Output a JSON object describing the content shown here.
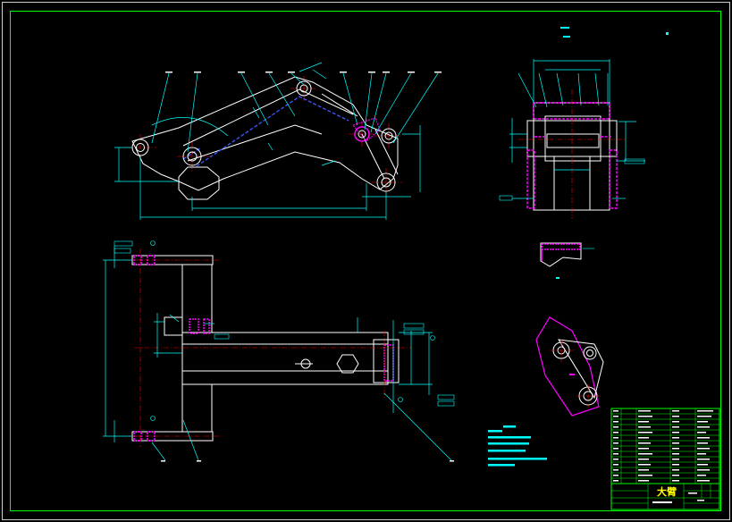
{
  "sheet": {
    "title_block": {
      "part_name": "大臂"
    }
  },
  "colors": {
    "background": "#000000",
    "frame": "#00ff00",
    "outline": "#ffffff",
    "dimension": "#00ffff",
    "centerline": "#ff0000",
    "hatch": "#ff00ff",
    "hidden": "#0000ff",
    "note_text": "#00ffff"
  }
}
